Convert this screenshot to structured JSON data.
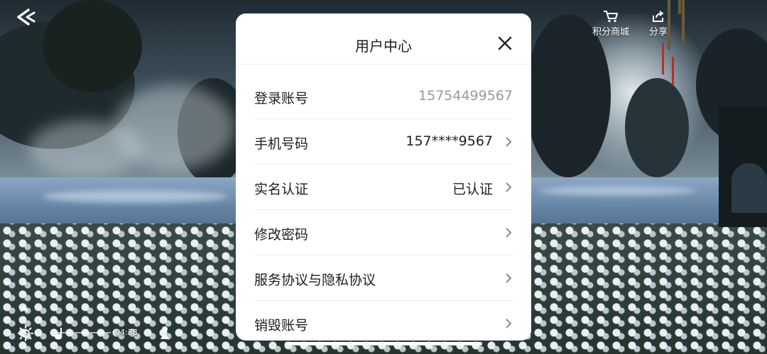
{
  "top_hud": {
    "points_mall_label": "积分商城",
    "share_label": "分享"
  },
  "bottom_hud": {
    "time": "04:38"
  },
  "modal": {
    "title": "用户中心",
    "rows": [
      {
        "label": "登录账号",
        "value": "15754499567",
        "has_chevron": false
      },
      {
        "label": "手机号码",
        "value": "157****9567",
        "has_chevron": true
      },
      {
        "label": "实名认证",
        "value": "已认证",
        "has_chevron": true
      },
      {
        "label": "修改密码",
        "value": "",
        "has_chevron": true
      },
      {
        "label": "服务协议与隐私协议",
        "value": "",
        "has_chevron": true
      },
      {
        "label": "销毁账号",
        "value": "",
        "has_chevron": true
      }
    ]
  },
  "icons": {
    "back": "back-arrow-icon",
    "cart": "shopping-cart-icon",
    "share": "share-icon",
    "close": "close-icon",
    "chevron": "chevron-right-icon"
  },
  "colors": {
    "modal_bg": "#ffffff",
    "text_primary": "#202020",
    "text_muted": "#9a9a9a",
    "divider": "#ececec",
    "chevron": "#8a8a8a"
  }
}
